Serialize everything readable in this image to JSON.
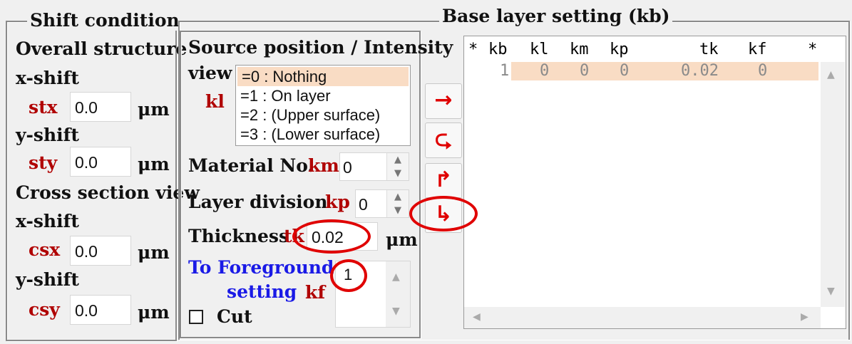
{
  "shift": {
    "title": "Shift condition",
    "overall": "Overall structure",
    "xshift_label": "x-shift",
    "yshift_label": "y-shift",
    "stx": {
      "name": "stx",
      "value": "0.0"
    },
    "sty": {
      "name": "sty",
      "value": "0.0"
    },
    "cross": "Cross section view",
    "csx": {
      "name": "csx",
      "value": "0.0"
    },
    "csy": {
      "name": "csy",
      "value": "0.0"
    },
    "unit": "μm"
  },
  "source": {
    "title": "Source position / Intensity",
    "view": "view",
    "kl": "kl",
    "options": [
      "=0 : Nothing",
      "=1 : On layer",
      "=2 : (Upper surface)",
      "=3 : (Lower surface)"
    ],
    "selected_index": 0,
    "material_label": "Material No.",
    "km": "km",
    "km_value": "0",
    "division_label": "Layer division",
    "kp": "kp",
    "kp_value": "0",
    "thickness_label": "Thickness",
    "tk": "tk",
    "tk_value": "0.02",
    "unit": "μm",
    "foreground_line1": "To Foreground",
    "foreground_line2": "setting",
    "kf": "kf",
    "kf_value": "1",
    "cut_label": "Cut",
    "cut_checked": false
  },
  "buttons": {
    "apply": "→",
    "replace": "⮎",
    "insert_up": "↱",
    "insert_down": "↳"
  },
  "base": {
    "title": "Base layer setting (kb)",
    "headers": [
      "*",
      "kb",
      "kl",
      "km",
      "kp",
      "tk",
      "kf",
      "*"
    ],
    "rows": [
      {
        "kb": "1",
        "kl": "0",
        "km": "0",
        "kp": "0",
        "tk": "0.02",
        "kf": "0"
      }
    ],
    "row_highlight": "#f9dcc4"
  },
  "colors": {
    "accent_red": "#e00000",
    "label_red": "#b00000",
    "blue": "#1a1ae6"
  }
}
